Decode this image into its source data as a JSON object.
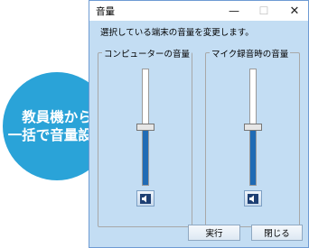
{
  "bubble": {
    "line1": "教員機から",
    "line2": "一括で音量設定"
  },
  "window": {
    "title": "音量",
    "controls": {
      "minimize": "—",
      "maximize": "☐",
      "close": "✕"
    },
    "description": "選択している端末の音量を変更します。"
  },
  "groups": [
    {
      "label": "コンピューターの音量",
      "level": 0.5,
      "icon": "speaker-icon"
    },
    {
      "label": "マイク録音時の音量",
      "level": 0.5,
      "icon": "speaker-icon"
    }
  ],
  "buttons": {
    "run": "実行",
    "close": "閉じる"
  },
  "colors": {
    "accent": "#2aa3d8",
    "window_body": "#c3ddf3",
    "slider_fill": "#1f6bb5"
  }
}
